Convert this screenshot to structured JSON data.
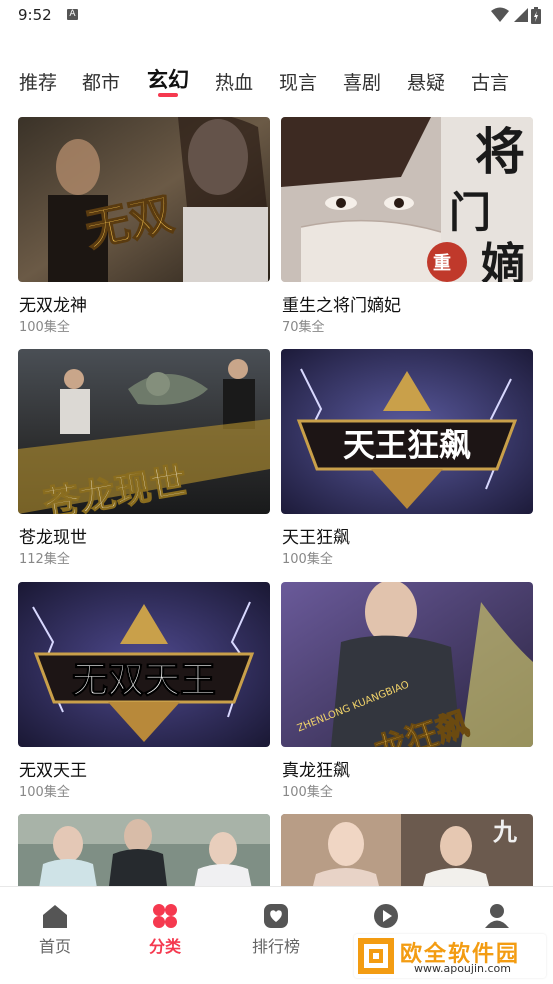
{
  "status": {
    "time": "9:52",
    "notif_letter": "A"
  },
  "tabs": [
    {
      "label": "推荐",
      "active": false
    },
    {
      "label": "都市",
      "active": false
    },
    {
      "label": "玄幻",
      "active": true
    },
    {
      "label": "热血",
      "active": false
    },
    {
      "label": "现言",
      "active": false
    },
    {
      "label": "喜剧",
      "active": false
    },
    {
      "label": "悬疑",
      "active": false
    },
    {
      "label": "古言",
      "active": false
    }
  ],
  "dramas": [
    {
      "title": "无双龙神",
      "episodes": "100集全",
      "poster_text": "无双"
    },
    {
      "title": "重生之将门嫡妃",
      "episodes": "70集全",
      "poster_text": "将门嫡",
      "poster_badge": "重生"
    },
    {
      "title": "苍龙现世",
      "episodes": "112集全",
      "poster_text": "苍龙现世"
    },
    {
      "title": "天王狂飙",
      "episodes": "100集全",
      "poster_text": "天王狂飙"
    },
    {
      "title": "无双天王",
      "episodes": "100集全",
      "poster_text": "无双天王"
    },
    {
      "title": "真龙狂飙",
      "episodes": "100集全",
      "poster_text": "龙狂飙",
      "poster_subtext": "ZHENLONG KUANGBIAO"
    },
    {
      "title": "",
      "episodes": ""
    },
    {
      "title": "",
      "episodes": "",
      "poster_text": "九"
    }
  ],
  "bottom_nav": [
    {
      "label": "首页",
      "icon": "home-icon",
      "active": false
    },
    {
      "label": "分类",
      "icon": "category-icon",
      "active": true
    },
    {
      "label": "排行榜",
      "icon": "ranking-icon",
      "active": false
    },
    {
      "label": "剧场",
      "icon": "theater-play-icon",
      "active": false
    },
    {
      "label": "我的",
      "icon": "profile-icon",
      "active": false
    }
  ],
  "watermark": {
    "title": "欧全软件园",
    "url": "www.apoujin.com"
  },
  "colors": {
    "accent": "#f5394f",
    "nav_inactive": "#666666",
    "watermark_orange": "#f39c12"
  }
}
